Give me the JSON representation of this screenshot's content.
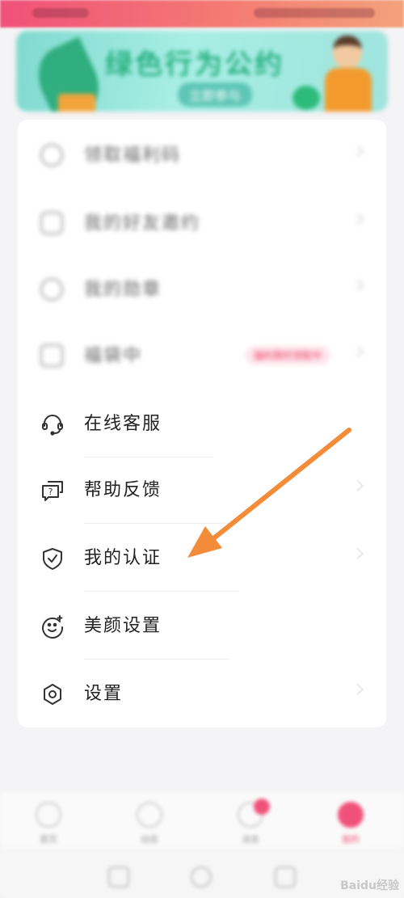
{
  "banner": {
    "title": "绿色行为公约",
    "subtitle": "立即参与"
  },
  "menu": {
    "items": [
      {
        "label": "领取福利码",
        "icon": "ticket-icon",
        "blurred": true
      },
      {
        "label": "我的好友邀约",
        "icon": "friends-icon",
        "blurred": true
      },
      {
        "label": "我的勋章",
        "icon": "medal-icon",
        "blurred": true
      },
      {
        "label": "福袋中",
        "icon": "gift-icon",
        "blurred": true,
        "badge": "福利限时领取中"
      },
      {
        "label": "在线客服",
        "icon": "headset-icon",
        "blurred": false
      },
      {
        "label": "帮助反馈",
        "icon": "chat-question-icon",
        "blurred": false
      },
      {
        "label": "我的认证",
        "icon": "shield-check-icon",
        "blurred": false
      },
      {
        "label": "美颜设置",
        "icon": "face-sparkle-icon",
        "blurred": false
      },
      {
        "label": "设置",
        "icon": "hexagon-settings-icon",
        "blurred": false
      }
    ]
  },
  "annotation": {
    "arrow_color": "#f28c38",
    "points_to": "我的认证"
  },
  "tabbar": {
    "tabs": [
      {
        "label": "首页",
        "active": false
      },
      {
        "label": "动态",
        "active": false
      },
      {
        "label": "消息",
        "active": false,
        "dot": true
      },
      {
        "label": "我的",
        "active": true
      }
    ]
  },
  "watermark": "Baidu经验",
  "colors": {
    "accent": "#f0517a",
    "background": "#f4f3f5",
    "card": "#ffffff"
  }
}
